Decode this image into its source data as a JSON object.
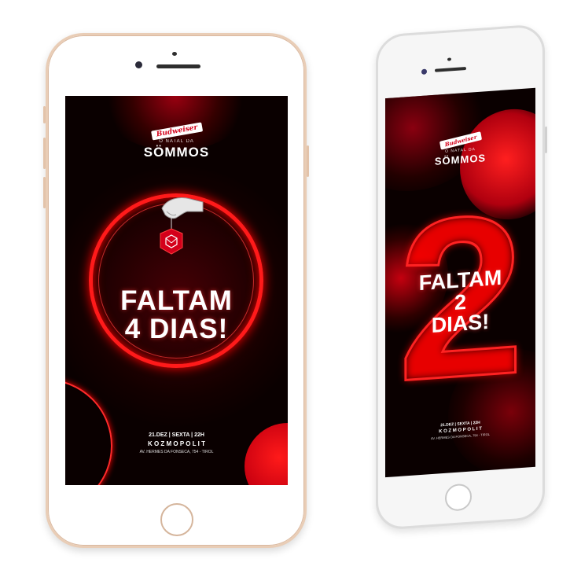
{
  "left_phone": {
    "sponsor": "Budweiser",
    "pretitle": "O NATAL DA",
    "brand": "SÖMMOS",
    "headline_line1": "FALTAM",
    "headline_line2": "4 DIAS!",
    "event_line": "21.DEZ | SEXTA | 22H",
    "venue": "K O Z M O P O L I T",
    "address": "AV. HERMES DA FONSECA, 754 - TIROL"
  },
  "right_phone": {
    "sponsor": "Budweiser",
    "pretitle": "O NATAL DA",
    "brand": "SÖMMOS",
    "big_number": "2",
    "headline_line1": "FALTAM",
    "headline_line2": "2",
    "headline_line3": "DIAS!",
    "event_line": "21.DEZ | SEXTA | 22H",
    "venue": "K O Z M O P O L I T",
    "address": "AV. HERMES DA FONSECA, 754 - TIROL"
  },
  "colors": {
    "accent_red": "#e3001b",
    "background_dark": "#0a0000",
    "gold_frame": "#e9cdb6",
    "silver_frame": "#dcdcdc"
  }
}
